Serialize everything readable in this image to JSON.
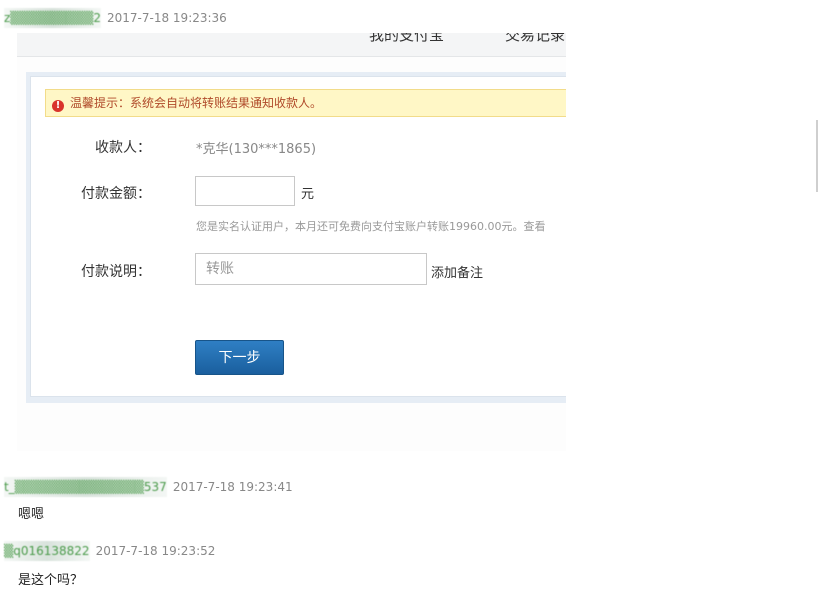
{
  "messages": [
    {
      "user": "z▒▒▒▒▒▒▒▒▒2",
      "time": "2017-7-18 19:23:36"
    },
    {
      "user": "t_▒▒▒▒▒▒▒▒▒▒▒▒▒▒537",
      "time": "2017-7-18 19:23:41",
      "text": "嗯嗯"
    },
    {
      "user": "▒q016138822",
      "time": "2017-7-18 19:23:52",
      "text": "是这个吗？"
    }
  ],
  "screenshot": {
    "nav": [
      "我的支付宝",
      "交易记录"
    ],
    "warning_icon": "!",
    "warning": "温馨提示：系统会自动将转账结果通知收款人。",
    "payee_label": "收款人：",
    "payee_value": "*克华(130***1865)",
    "amount_label": "付款金额：",
    "amount_unit": "元",
    "hint": "您是实名认证用户，本月还可免费向支付宝账户转账19960.00元。查看",
    "note_label": "付款说明：",
    "note_value": "转账",
    "add_note": "添加备注",
    "next_button": "下一步"
  },
  "colors": {
    "accent": "#1a5f9e",
    "warning_bg": "#fff7c6",
    "warning_text": "#b04a2a",
    "username": "#4a9a4a"
  }
}
